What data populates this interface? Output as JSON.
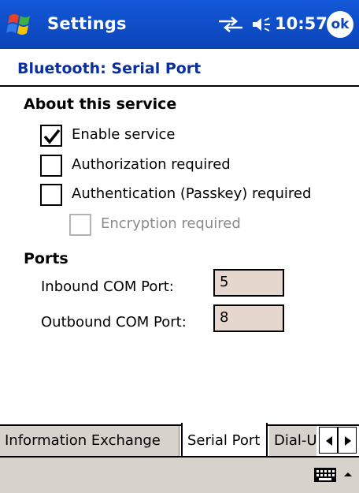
{
  "titlebar": {
    "app_title": "Settings",
    "clock": "10:57",
    "ok_label": "ok"
  },
  "page": {
    "title": "Bluetooth: Serial Port"
  },
  "about": {
    "heading": "About this service",
    "enable_service": {
      "label": "Enable service",
      "checked": true
    },
    "authorization": {
      "label": "Authorization required",
      "checked": false
    },
    "authentication": {
      "label": "Authentication (Passkey) required",
      "checked": false
    },
    "encryption": {
      "label": "Encryption required",
      "checked": false,
      "enabled": false
    }
  },
  "ports": {
    "heading": "Ports",
    "inbound_label": "Inbound COM Port:",
    "inbound_value": "5",
    "outbound_label": "Outbound COM Port:",
    "outbound_value": "8"
  },
  "tabs": [
    {
      "label": "Information Exchange",
      "active": false
    },
    {
      "label": "Serial Port",
      "active": true
    },
    {
      "label": "Dial-U",
      "active": false
    }
  ],
  "icons": {
    "start": "windows-flag-icon",
    "connectivity": "sync-arrows-icon",
    "volume": "speaker-icon",
    "keyboard": "keyboard-icon",
    "sip": "up-arrow-icon"
  },
  "colors": {
    "titlebar": "#0b44b8",
    "page_title": "#0b2f9c",
    "field_bg": "#e5d7cd",
    "tab_bg": "#d8d2cc"
  }
}
